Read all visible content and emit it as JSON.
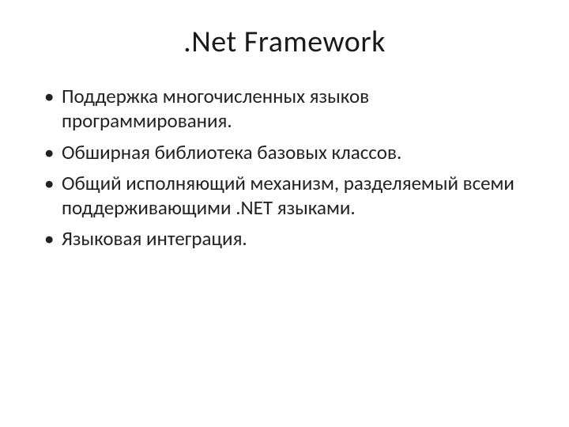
{
  "title": ".Net Framework",
  "bullets": [
    "Поддержка многочисленных языков программирования.",
    "Обширная библиотека базовых классов.",
    "Общий исполняющий механизм, разделяемый всеми поддерживающими .NET языками.",
    "Языковая интеграция."
  ]
}
